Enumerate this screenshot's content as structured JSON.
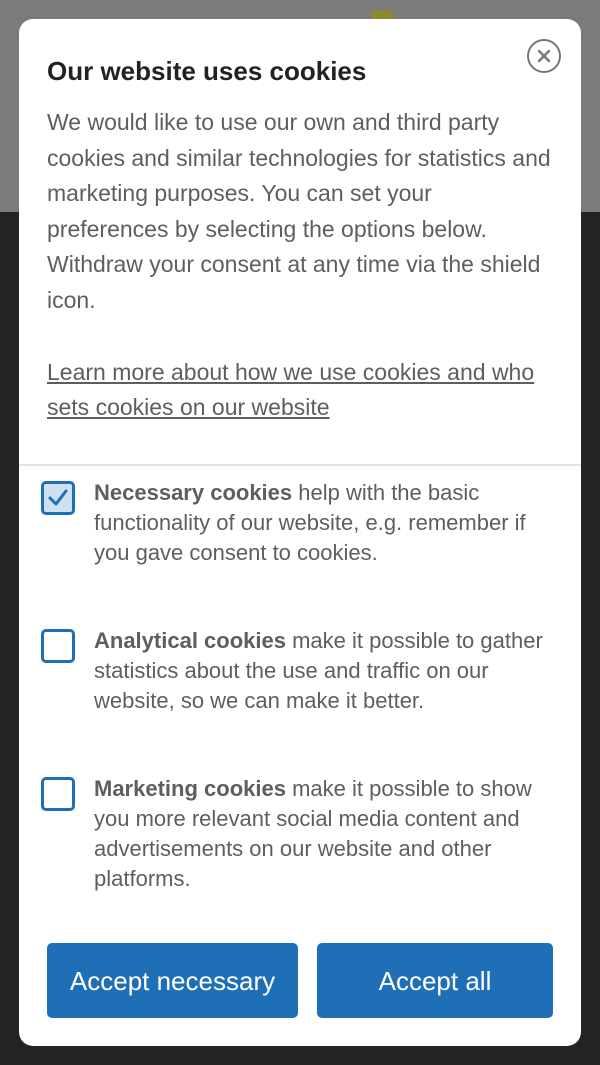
{
  "dialog": {
    "title": "Our website uses cookies",
    "intro": "We would like to use our own and third party cookies and similar technologies for statistics and marketing purposes. You can set your preferences by selecting the options below. Withdraw your consent at any time via the shield icon.",
    "learn_more": "Learn more about how we use cookies and who sets cookies on our website",
    "close_icon": "close-circle-icon"
  },
  "options": [
    {
      "name": "Necessary cookies",
      "description": " help with the basic functionality of our website, e.g. remember if you gave consent to cookies.",
      "checked": true
    },
    {
      "name": "Analytical cookies",
      "description": " make it possible to gather statistics about the use and traffic on our website, so we can make it better.",
      "checked": false
    },
    {
      "name": "Marketing cookies",
      "description": " make it possible to show you more relevant social media content and advertisements on our website and other platforms.",
      "checked": false
    }
  ],
  "buttons": {
    "accept_necessary": "Accept necessary",
    "accept_all": "Accept all"
  },
  "colors": {
    "accent": "#1f6fb7",
    "text": "#5e5e5e",
    "title": "#222222",
    "overlay_top": "#7b7b7b",
    "overlay_bottom": "#232323"
  }
}
